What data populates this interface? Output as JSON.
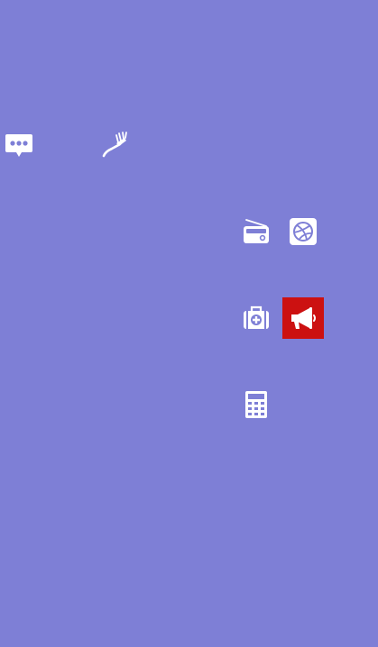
{
  "screen": {
    "background": "#7e7fd6"
  },
  "colors": {
    "icon": "#ffffff",
    "highlight": "#cc1111"
  },
  "icons": [
    {
      "id": "chat",
      "name": "chat-bubble-icon",
      "selected": false
    },
    {
      "id": "brush",
      "name": "toothbrush-icon",
      "selected": false
    },
    {
      "id": "radio",
      "name": "radio-icon",
      "selected": false
    },
    {
      "id": "dribbble",
      "name": "dribbble-icon",
      "selected": false
    },
    {
      "id": "medkit",
      "name": "medkit-icon",
      "selected": false
    },
    {
      "id": "megaphone",
      "name": "megaphone-icon",
      "selected": true
    },
    {
      "id": "calc",
      "name": "calculator-icon",
      "selected": false
    }
  ]
}
